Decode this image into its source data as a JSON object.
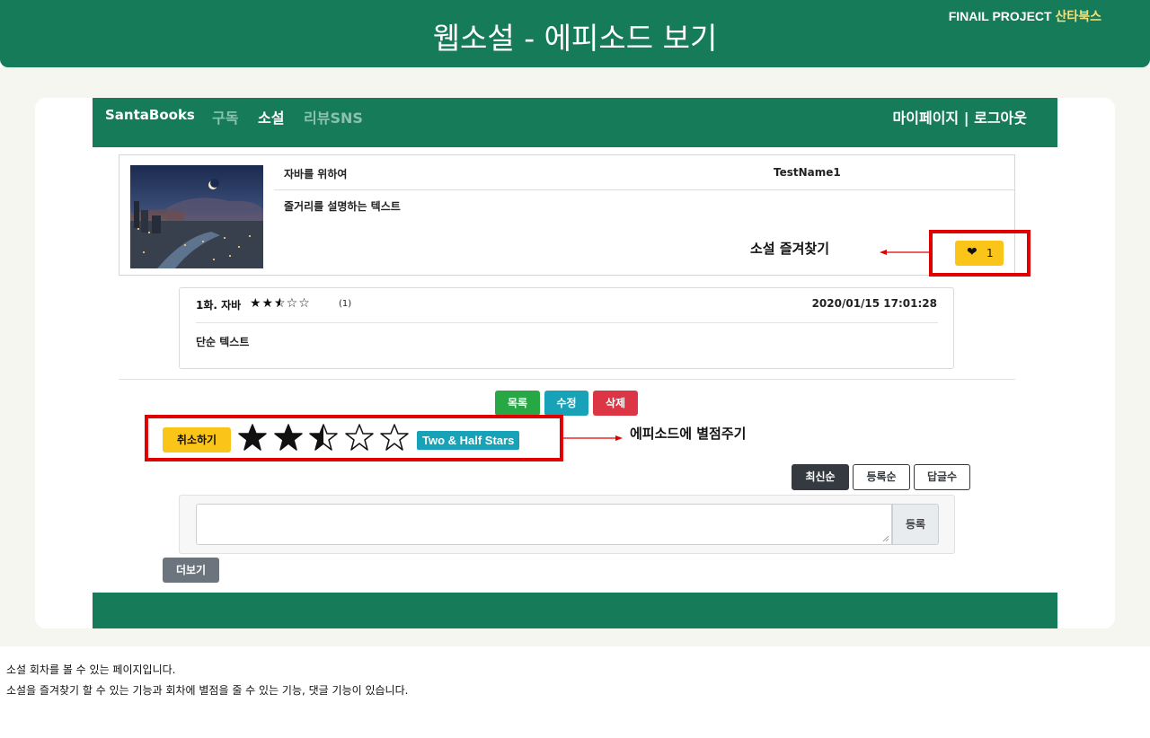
{
  "banner": {
    "title": "웹소설 - 에피소드 보기",
    "project_label": "FINAIL PROJECT",
    "project_name": "산타북스"
  },
  "navbar": {
    "brand": "SantaBooks",
    "items": [
      {
        "label": "구독",
        "active": false
      },
      {
        "label": "소설",
        "active": true
      },
      {
        "label": "리뷰SNS",
        "active": false
      }
    ],
    "right": "마이페이지 | 로그아웃"
  },
  "novel": {
    "title": "자바를 위하여",
    "author": "TestName1",
    "description": "줄거리를 설명하는 텍스트",
    "favorite_count": "1",
    "cover_icon": "night-city-cover-image"
  },
  "annotations": {
    "favorite": "소설 즐겨찾기",
    "rating": "에피소드에 별점주기"
  },
  "episode": {
    "title": "1화. 자바",
    "rating": 2.5,
    "rating_count": "(1)",
    "date": "2020/01/15 17:01:28",
    "body": "단순 텍스트"
  },
  "actions": {
    "list": "목록",
    "edit": "수정",
    "delete": "삭제"
  },
  "rating_widget": {
    "cancel": "취소하기",
    "value": 2.5,
    "label": "Two & Half Stars"
  },
  "sort": {
    "newest": "최신순",
    "registered": "등록순",
    "replies": "답글수"
  },
  "comment": {
    "placeholder": "",
    "submit": "등록"
  },
  "more": "더보기",
  "captions": [
    "소설 회차를 볼 수 있는 페이지입니다.",
    "소설을 즐겨찾기 할 수 있는 기능과 회차에 별점을 줄 수 있는 기능, 댓글 기능이 있습니다."
  ],
  "colors": {
    "brand_green": "#157b59",
    "warning_yellow": "#fbc418",
    "info_teal": "#17a2b8",
    "danger_red": "#dc3545",
    "success_green": "#28a745",
    "annotation_red": "#e00000"
  }
}
